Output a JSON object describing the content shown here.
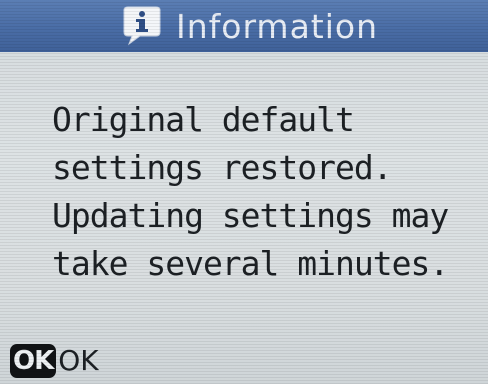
{
  "dialog": {
    "title": "Information",
    "icon": "info-speech-bubble-icon",
    "message_lines": [
      "Original default",
      "settings restored.",
      "Updating settings may",
      "take several minutes."
    ]
  },
  "softkeys": {
    "ok_key": "OK",
    "ok_label": "OK"
  },
  "colors": {
    "title_bar": "#4a6da6",
    "screen_bg": "#d9dee0",
    "text": "#1c2024"
  }
}
